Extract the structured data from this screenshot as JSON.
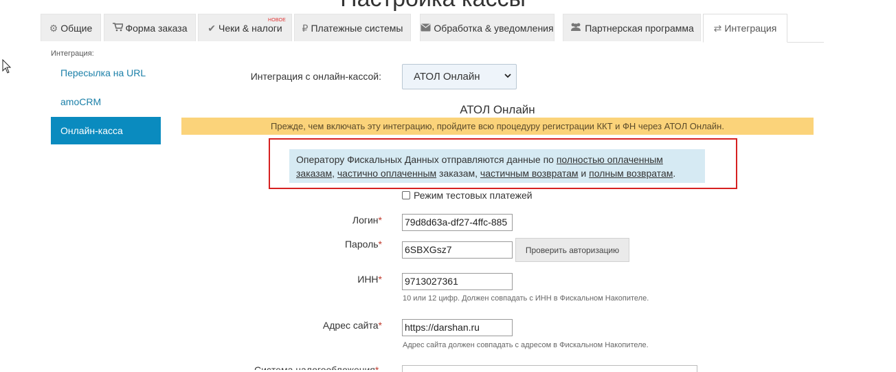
{
  "page": {
    "title": "Настройка кассы"
  },
  "tabs": [
    {
      "label": "Общие",
      "icon": "gear-icon"
    },
    {
      "label": "Форма заказа",
      "icon": "cart-icon"
    },
    {
      "label": "Чеки & налоги",
      "icon": "check-icon",
      "badge": "НОВОЕ"
    },
    {
      "label": "Платежные системы",
      "icon": "ruble-icon"
    },
    {
      "label": "Обработка & уведомления",
      "icon": "envelope-icon"
    },
    {
      "label": "Партнерская программа",
      "icon": "users-icon"
    },
    {
      "label": "Интеграция",
      "icon": "exchange-icon",
      "active": true
    }
  ],
  "sidebar": {
    "caption": "Интеграция:",
    "items": [
      {
        "label": "Пересылка на URL"
      },
      {
        "label": "amoCRM"
      },
      {
        "label": "Онлайн-касса",
        "active": true
      }
    ]
  },
  "integration": {
    "label": "Интеграция с онлайн-кассой:",
    "selected": "АТОЛ Онлайн",
    "section_title": "АТОЛ Онлайн",
    "warning": "Прежде, чем включать эту интеграцию, пройдите всю процедуру регистрации ККТ и ФН через АТОЛ Онлайн.",
    "info": {
      "t1": "Оператору Фискальных Данных отправляются данные по ",
      "l1": "полностью оплаченным заказам",
      "t2": ", ",
      "l2": "частично оплаченным",
      "t3": " заказам, ",
      "l3": "частичным возвратам",
      "t4": " и ",
      "l4": "полным возвратам",
      "t5": "."
    },
    "test_mode_label": "Режим тестовых платежей"
  },
  "form": {
    "required_mark": "*",
    "login": {
      "label": "Логин",
      "value": "79d8d63a-df27-4ffc-885"
    },
    "password": {
      "label": "Пароль",
      "value": "6SBXGsz7",
      "check_button": "Проверить авторизацию"
    },
    "inn": {
      "label": "ИНН",
      "value": "9713027361",
      "hint": "10 или 12 цифр. Должен совпадать с ИНН в Фискальном Накопителе."
    },
    "site": {
      "label": "Адрес сайта",
      "value": "https://darshan.ru",
      "hint": "Адрес сайта должен совпадать с адресом в Фискальном Накопителе."
    },
    "next_label": "Система налогообложения"
  },
  "colors": {
    "accent": "#0a8bbf",
    "warning": "#fbd37a",
    "info": "#d6eaf3",
    "highlight": "#d62020",
    "link": "#1a7fa8"
  }
}
